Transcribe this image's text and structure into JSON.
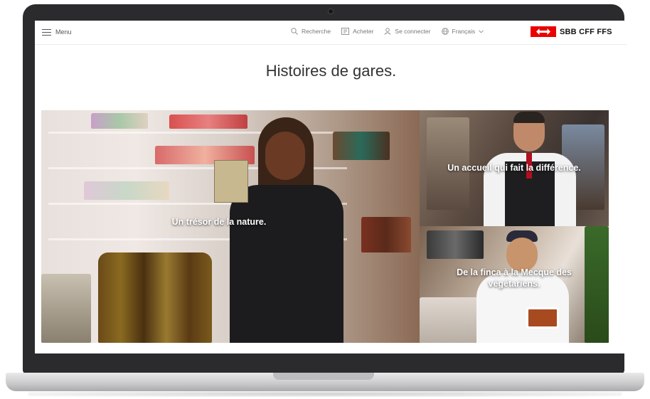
{
  "header": {
    "menu_label": "Menu",
    "nav": {
      "search": "Recherche",
      "buy": "Acheter",
      "login": "Se connecter",
      "language": "Français"
    },
    "logo_text": "SBB CFF FFS",
    "logo_color": "#eb0000"
  },
  "page": {
    "title": "Histoires de gares."
  },
  "stories": [
    {
      "caption": "Un trésor de la nature."
    },
    {
      "caption": "Un accueil qui fait la différence."
    },
    {
      "caption": "De la finca à la Mecque des végétariens."
    }
  ]
}
